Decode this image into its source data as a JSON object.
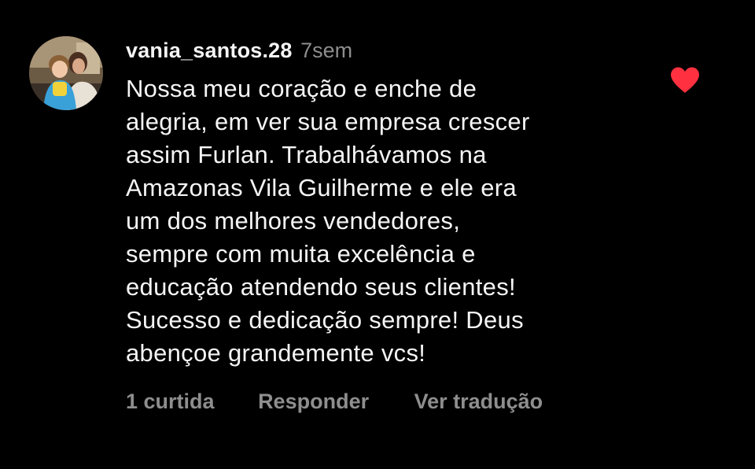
{
  "comment": {
    "username": "vania_santos.28",
    "timestamp": "7sem",
    "text": "Nossa meu coração e enche de\nalegria, em ver sua empresa crescer\nassim Furlan. Trabalhávamos na\nAmazonas Vila Guilherme e ele era\num dos melhores vendedores,\nsempre com muita excelência e\neducação atendendo seus clientes!\nSucesso e dedicação sempre! Deus\nabençoe grandemente vcs!",
    "liked": true,
    "like_icon": "heart-icon",
    "like_color": "#ff3040"
  },
  "actions": {
    "likes_count": "1 curtida",
    "reply_label": "Responder",
    "translate_label": "Ver tradução"
  },
  "colors": {
    "background": "#000000",
    "text_primary": "#f5f5f5",
    "text_secondary": "#8e8e8e"
  }
}
